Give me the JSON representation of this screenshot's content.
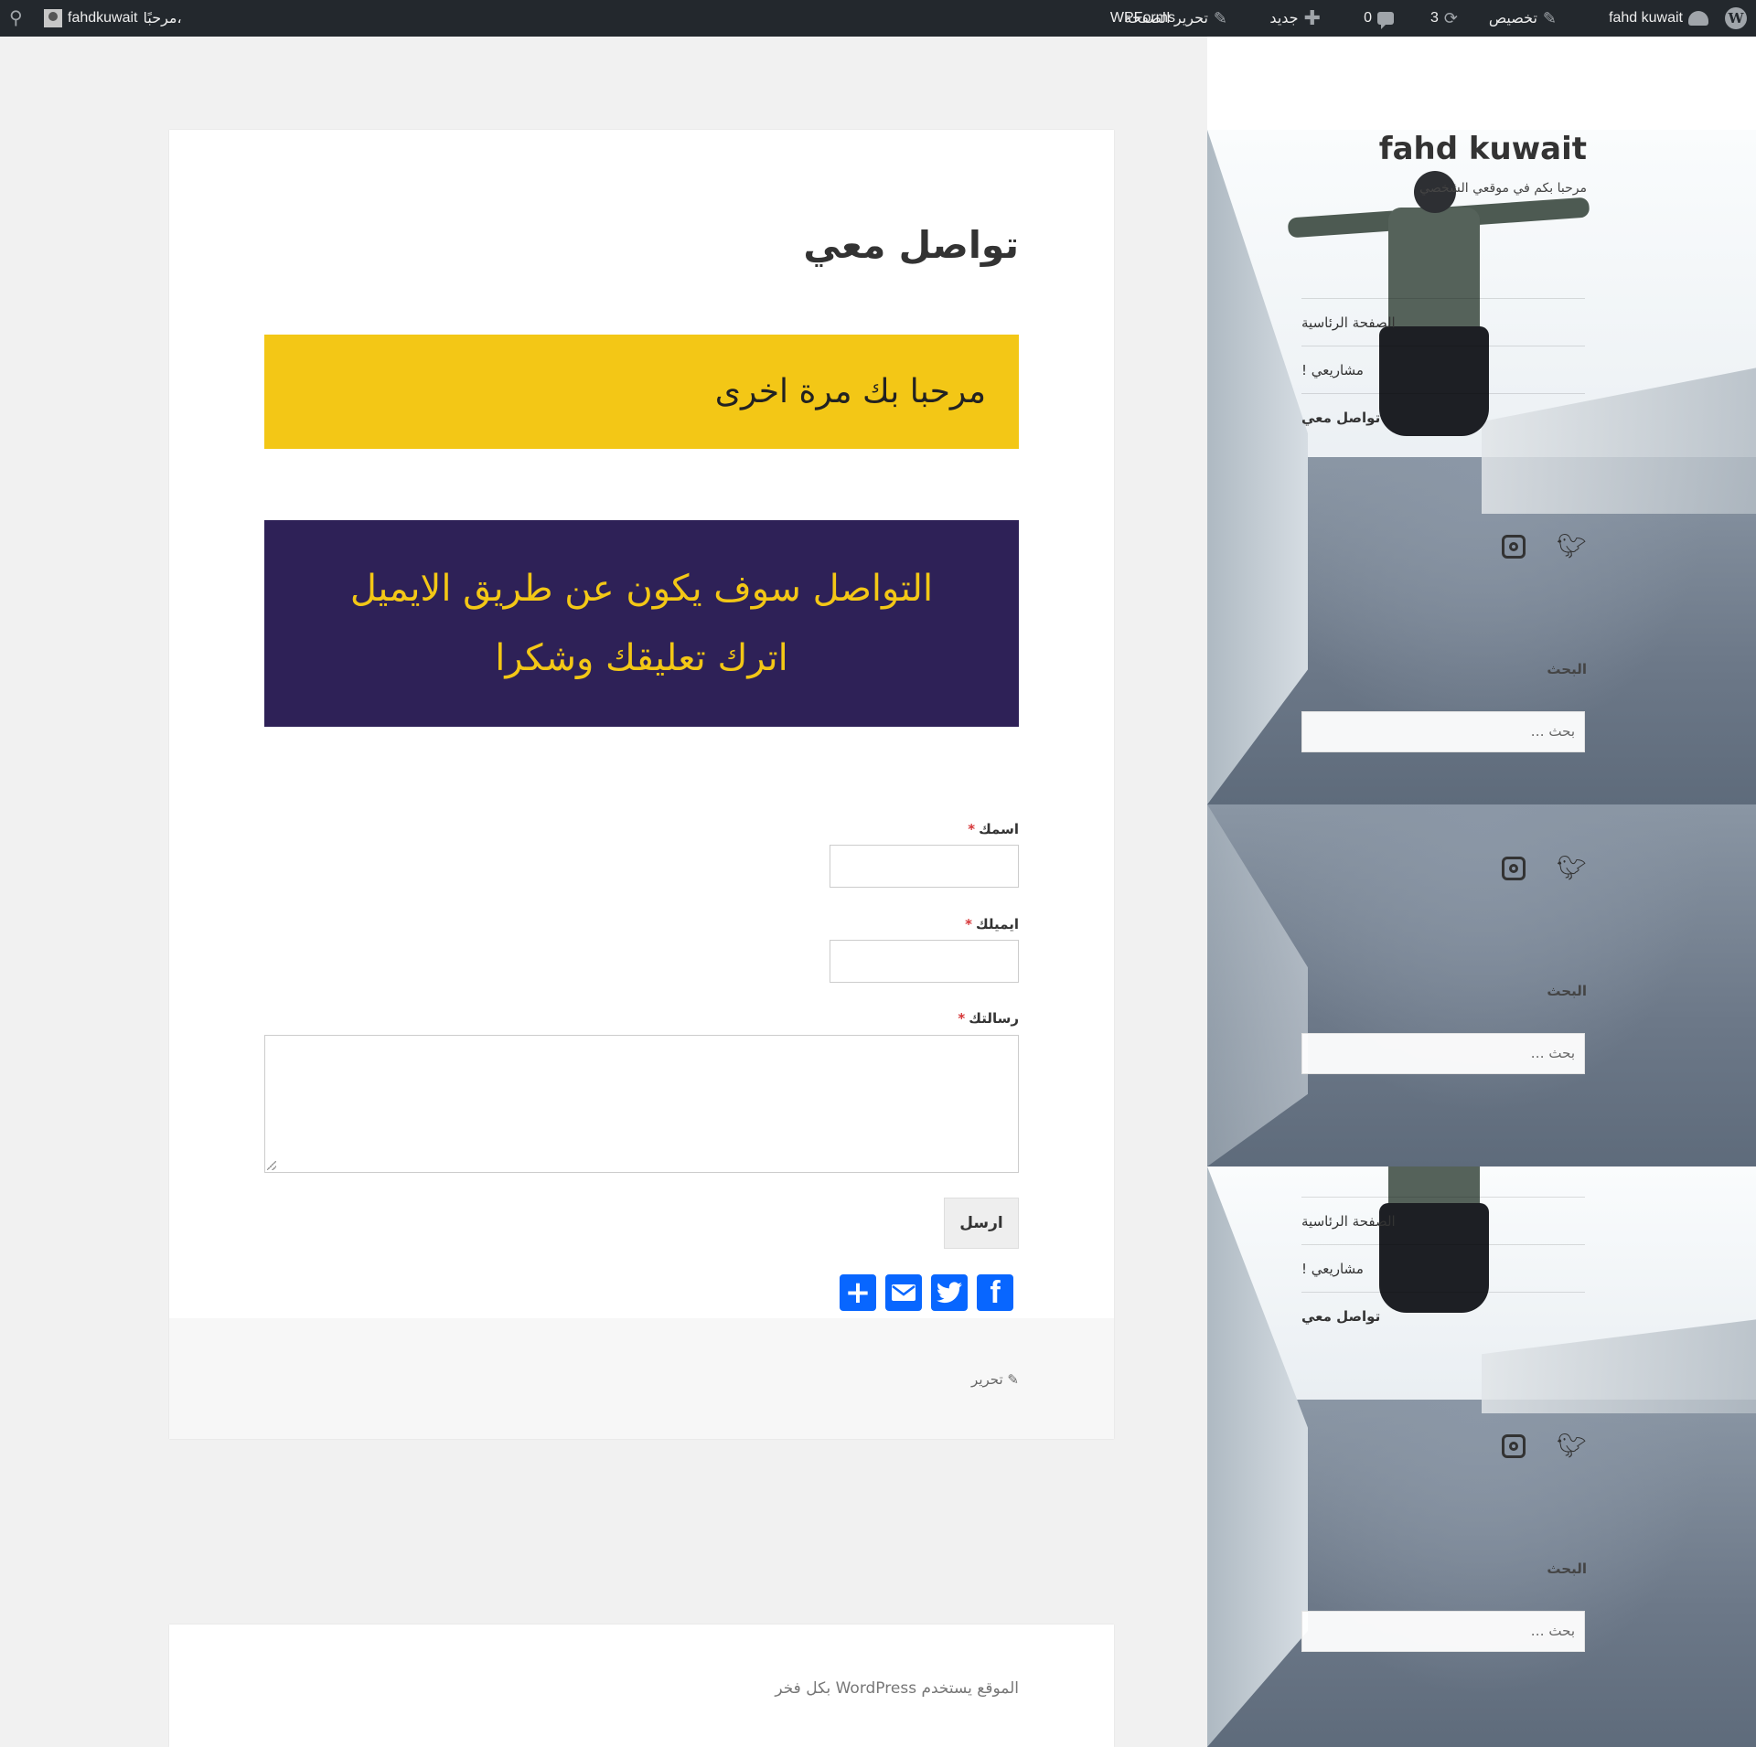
{
  "adminbar": {
    "site_name": "fahd kuwait",
    "customize": "تخصيص",
    "updates_count": "3",
    "comments_count": "0",
    "new": "جديد",
    "edit_page": "تحرير الصفحة",
    "wpforms": "WPForms",
    "howdy": "مرحبًا،",
    "username": "fahdkuwait"
  },
  "page": {
    "title": "تواصل معي",
    "yellow_text": "مرحبا بك مرة اخرى",
    "purple_line1": "التواصل سوف يكون عن طريق الايميل",
    "purple_line2": "اترك تعليقك وشكرا"
  },
  "form": {
    "name_label": "اسمك",
    "email_label": "ايميلك",
    "message_label": "رسالتك",
    "required_mark": "*",
    "submit": "ارسل"
  },
  "share": {
    "icons": [
      "facebook-icon",
      "twitter-icon",
      "email-icon",
      "share-plus-icon"
    ],
    "color": "#0866ff"
  },
  "entry_footer": {
    "edit": "تحرير"
  },
  "footer": {
    "powered": "الموقع يستخدم WordPress بكل فخر"
  },
  "sidebar": {
    "site_title": "fahd kuwait",
    "site_description": "مرحبا بكم في موقعي الشخصي",
    "nav": [
      "الصفحة الرئاسية",
      "مشاريعي !",
      "تواصل معي"
    ],
    "search_title": "البحث",
    "search_placeholder": "بحث …"
  },
  "colors": {
    "accent_yellow": "#f3c716",
    "accent_purple": "#2e2157",
    "adminbar": "#23282d"
  }
}
